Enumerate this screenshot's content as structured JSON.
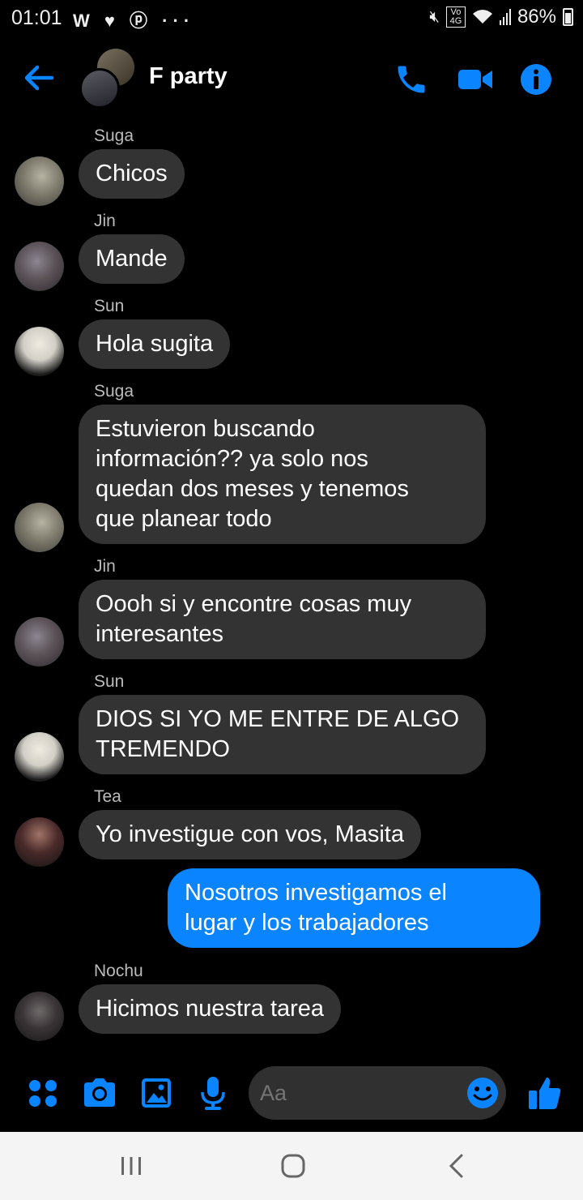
{
  "status_bar": {
    "time": "01:01",
    "left_icons": "W ♥ ⓟ ···",
    "network": "Vo 4G",
    "battery": "86%"
  },
  "header": {
    "title": "F party",
    "icons": [
      "back-arrow-icon",
      "phone-icon",
      "video-camera-icon",
      "info-icon"
    ],
    "accent_color": "#0a84ff"
  },
  "messages": [
    {
      "sender": "Suga",
      "text": "Chicos",
      "outgoing": false
    },
    {
      "sender": "Jin",
      "text": "Mande",
      "outgoing": false
    },
    {
      "sender": "Sun",
      "text": "Hola sugita",
      "outgoing": false
    },
    {
      "sender": "Suga",
      "text": "Estuvieron buscando\ninformación?? ya solo nos\nquedan dos meses y tenemos\nque planear todo",
      "outgoing": false
    },
    {
      "sender": "Jin",
      "text": "Oooh si y encontre cosas muy\ninteresantes",
      "outgoing": false
    },
    {
      "sender": "Sun",
      "text": "DIOS SI YO ME ENTRE DE ALGO\nTREMENDO",
      "outgoing": false
    },
    {
      "sender": "Tea",
      "text": "Yo investigue con vos, Masita",
      "outgoing": false
    },
    {
      "sender": "",
      "text": "Nosotros investigamos el\nlugar y los trabajadores",
      "outgoing": true
    },
    {
      "sender": "Nochu",
      "text": "Hicimos nuestra tarea",
      "outgoing": false
    }
  ],
  "composer": {
    "placeholder": "Aa",
    "icons": [
      "apps-grid-icon",
      "camera-icon",
      "gallery-icon",
      "microphone-icon",
      "emoji-icon",
      "thumbs-up-icon"
    ]
  },
  "navbar": {
    "icons": [
      "recent-apps-icon",
      "home-icon",
      "back-icon"
    ]
  }
}
